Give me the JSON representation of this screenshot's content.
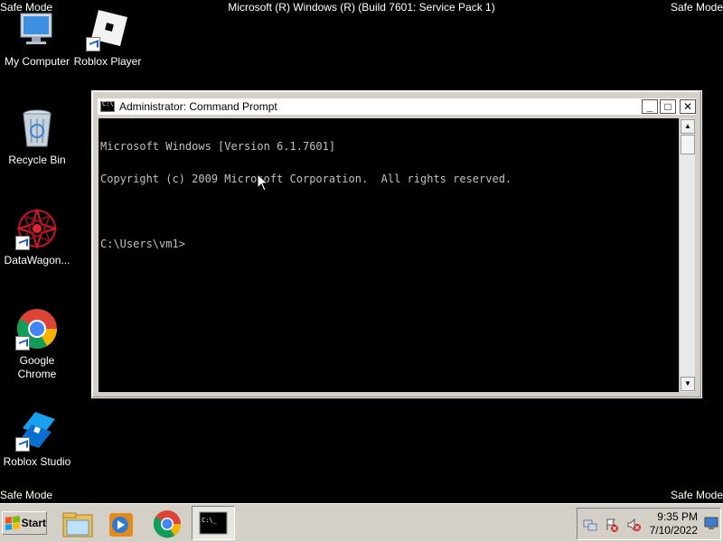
{
  "overlay": {
    "safe_mode": "Safe Mode",
    "build": "Microsoft (R) Windows (R) (Build 7601: Service Pack 1)"
  },
  "desktop_icons": [
    {
      "label": "My Computer",
      "icon": "computer-icon"
    },
    {
      "label": "Roblox Player",
      "icon": "roblox-player-icon"
    },
    {
      "label": "Recycle Bin",
      "icon": "recycle-bin-icon"
    },
    {
      "label": "DataWagon...",
      "icon": "datawagon-icon"
    },
    {
      "label": "Google Chrome",
      "icon": "chrome-icon"
    },
    {
      "label": "Roblox Studio",
      "icon": "roblox-studio-icon"
    }
  ],
  "window": {
    "title": "Administrator: Command Prompt",
    "minimize": "_",
    "maximize": "□",
    "close": "✕",
    "console_lines": [
      "Microsoft Windows [Version 6.1.7601]",
      "Copyright (c) 2009 Microsoft Corporation.  All rights reserved.",
      "",
      "C:\\Users\\vm1>"
    ]
  },
  "taskbar": {
    "start_label": "Start",
    "pinned": [
      "explorer-icon",
      "media-player-icon",
      "chrome-icon",
      "cmd-icon"
    ],
    "tray_icons": [
      "network-icon",
      "action-center-icon",
      "volume-muted-icon"
    ],
    "time": "9:35 PM",
    "date": "7/10/2022"
  },
  "colors": {
    "desktop": "#000000",
    "console_bg": "#000000",
    "console_text": "#c0c0c0",
    "chrome_accent": "#4285f4"
  }
}
